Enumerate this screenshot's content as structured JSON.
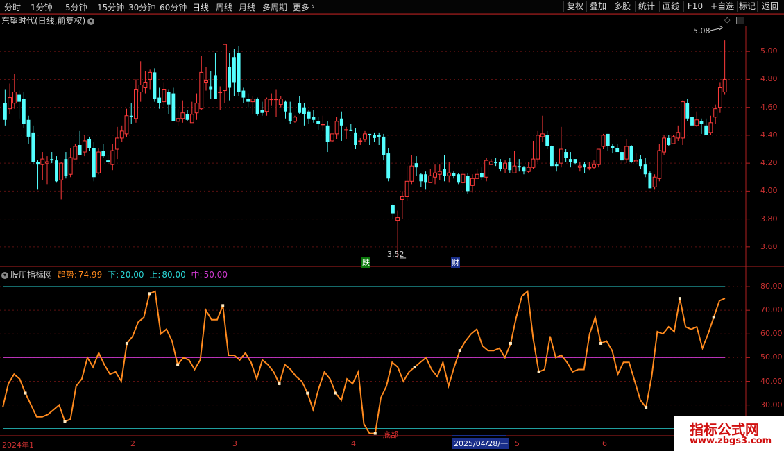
{
  "toolbar": {
    "timeframes": [
      "分时",
      "1分钟",
      "5分钟",
      "15分钟",
      "30分钟",
      "60分钟",
      "日线",
      "周线",
      "月线",
      "多周期",
      "更多"
    ],
    "active": "日线",
    "right_buttons": [
      "复权",
      "叠加",
      "多股",
      "统计",
      "画线",
      "F10",
      "+自选",
      "返回"
    ]
  },
  "main_chart": {
    "title": "东望时代(日线,前复权)",
    "y_ticks": [
      "5.00",
      "4.80",
      "4.60",
      "4.40",
      "4.20",
      "4.00",
      "3.80",
      "3.60"
    ],
    "y_range": [
      3.46,
      5.18
    ],
    "high_label": "5.08",
    "low_label": "3.52",
    "marker_die": "跌",
    "marker_cai": "财",
    "candles": [
      [
        4.63,
        4.51,
        4.73,
        4.47
      ],
      [
        4.59,
        4.67,
        4.77,
        4.55
      ],
      [
        4.63,
        4.71,
        4.84,
        4.59
      ],
      [
        4.69,
        4.64,
        4.72,
        4.52
      ],
      [
        4.66,
        4.48,
        4.71,
        4.45
      ],
      [
        4.51,
        4.39,
        4.54,
        4.34
      ],
      [
        4.42,
        4.21,
        4.47,
        4.19
      ],
      [
        4.21,
        4.19,
        4.22,
        4.01
      ],
      [
        4.19,
        4.23,
        4.28,
        4.08
      ],
      [
        4.2,
        4.21,
        4.25,
        4.05
      ],
      [
        4.23,
        4.22,
        4.28,
        4.2
      ],
      [
        4.22,
        4.07,
        4.25,
        4.06
      ],
      [
        4.08,
        4.2,
        4.21,
        3.94
      ],
      [
        4.23,
        4.11,
        4.28,
        4.09
      ],
      [
        4.12,
        4.24,
        4.31,
        4.1
      ],
      [
        4.23,
        4.32,
        4.34,
        4.23
      ],
      [
        4.33,
        4.26,
        4.43,
        4.26
      ],
      [
        4.28,
        4.36,
        4.4,
        4.25
      ],
      [
        4.37,
        4.31,
        4.39,
        4.29
      ],
      [
        4.31,
        4.1,
        4.35,
        4.07
      ],
      [
        4.13,
        4.28,
        4.31,
        4.12
      ],
      [
        4.29,
        4.25,
        4.34,
        4.24
      ],
      [
        4.22,
        4.21,
        4.26,
        4.19
      ],
      [
        4.19,
        4.29,
        4.34,
        4.15
      ],
      [
        4.3,
        4.38,
        4.46,
        4.23
      ],
      [
        4.38,
        4.43,
        4.47,
        4.35
      ],
      [
        4.41,
        4.54,
        4.59,
        4.39
      ],
      [
        4.54,
        4.53,
        4.63,
        4.48
      ],
      [
        4.52,
        4.73,
        4.8,
        4.49
      ],
      [
        4.71,
        4.76,
        4.93,
        4.64
      ],
      [
        4.74,
        4.78,
        4.86,
        4.7
      ],
      [
        4.8,
        4.85,
        4.87,
        4.73
      ],
      [
        4.85,
        4.66,
        4.88,
        4.64
      ],
      [
        4.67,
        4.63,
        4.74,
        4.59
      ],
      [
        4.64,
        4.73,
        4.78,
        4.61
      ],
      [
        4.71,
        4.62,
        4.73,
        4.55
      ],
      [
        4.7,
        4.5,
        4.74,
        4.5
      ],
      [
        4.5,
        4.52,
        4.59,
        4.47
      ],
      [
        4.52,
        4.56,
        4.65,
        4.49
      ],
      [
        4.55,
        4.51,
        4.58,
        4.5
      ],
      [
        4.49,
        4.55,
        4.64,
        4.49
      ],
      [
        4.56,
        4.63,
        4.7,
        4.51
      ],
      [
        4.59,
        4.85,
        4.97,
        4.58
      ],
      [
        4.78,
        4.79,
        4.89,
        4.72
      ],
      [
        4.75,
        4.73,
        4.86,
        4.66
      ],
      [
        4.83,
        4.66,
        4.99,
        4.66
      ],
      [
        4.71,
        4.71,
        4.75,
        4.58
      ],
      [
        4.72,
        5.05,
        5.05,
        4.63
      ],
      [
        4.89,
        4.74,
        4.99,
        4.65
      ],
      [
        4.96,
        4.78,
        5.02,
        4.68
      ],
      [
        4.99,
        4.71,
        5.04,
        4.68
      ],
      [
        4.72,
        4.67,
        4.74,
        4.63
      ],
      [
        4.66,
        4.64,
        4.7,
        4.6
      ],
      [
        4.64,
        4.66,
        4.68,
        4.55
      ],
      [
        4.66,
        4.55,
        4.67,
        4.54
      ],
      [
        4.58,
        4.56,
        4.64,
        4.54
      ],
      [
        4.57,
        4.66,
        4.67,
        4.54
      ],
      [
        4.66,
        4.66,
        4.7,
        4.61
      ],
      [
        4.66,
        4.66,
        4.73,
        4.53
      ],
      [
        4.62,
        4.66,
        4.68,
        4.6
      ],
      [
        4.64,
        4.57,
        4.65,
        4.52
      ],
      [
        4.56,
        4.5,
        4.64,
        4.48
      ],
      [
        4.5,
        4.53,
        4.54,
        4.49
      ],
      [
        4.63,
        4.56,
        4.68,
        4.55
      ],
      [
        4.6,
        4.55,
        4.63,
        4.47
      ],
      [
        4.57,
        4.52,
        4.58,
        4.48
      ],
      [
        4.53,
        4.51,
        4.58,
        4.49
      ],
      [
        4.5,
        4.48,
        4.53,
        4.44
      ],
      [
        4.48,
        4.48,
        4.54,
        4.43
      ],
      [
        4.47,
        4.35,
        4.5,
        4.28
      ],
      [
        4.36,
        4.41,
        4.41,
        4.35
      ],
      [
        4.41,
        4.5,
        4.53,
        4.37
      ],
      [
        4.52,
        4.47,
        4.57,
        4.36
      ],
      [
        4.44,
        4.44,
        4.46,
        4.37
      ],
      [
        4.44,
        4.43,
        4.48,
        4.43
      ],
      [
        4.42,
        4.33,
        4.45,
        4.3
      ],
      [
        4.36,
        4.36,
        4.38,
        4.33
      ],
      [
        4.37,
        4.41,
        4.43,
        4.35
      ],
      [
        4.41,
        4.4,
        4.41,
        4.33
      ],
      [
        4.4,
        4.38,
        4.42,
        4.35
      ],
      [
        4.4,
        4.39,
        4.42,
        4.33
      ],
      [
        4.39,
        4.26,
        4.41,
        4.22
      ],
      [
        4.27,
        4.09,
        4.31,
        4.07
      ],
      [
        3.9,
        3.84,
        3.91,
        3.8
      ],
      [
        3.79,
        3.81,
        3.86,
        3.52
      ],
      [
        3.94,
        3.96,
        4.0,
        3.8
      ],
      [
        3.96,
        4.07,
        4.18,
        3.93
      ],
      [
        4.07,
        4.18,
        4.26,
        4.05
      ],
      [
        4.2,
        4.17,
        4.25,
        4.11
      ],
      [
        4.12,
        4.07,
        4.13,
        4.03
      ],
      [
        4.12,
        4.06,
        4.14,
        4.01
      ],
      [
        4.06,
        4.11,
        4.16,
        4.06
      ],
      [
        4.1,
        4.13,
        4.19,
        4.05
      ],
      [
        4.12,
        4.14,
        4.19,
        4.08
      ],
      [
        4.16,
        4.11,
        4.26,
        4.07
      ],
      [
        4.11,
        4.13,
        4.21,
        4.06
      ],
      [
        4.13,
        4.11,
        4.14,
        4.09
      ],
      [
        4.12,
        4.06,
        4.13,
        4.05
      ],
      [
        4.06,
        4.12,
        4.15,
        4.05
      ],
      [
        4.11,
        4.0,
        4.13,
        3.98
      ],
      [
        4.04,
        4.09,
        4.12,
        3.99
      ],
      [
        4.09,
        4.12,
        4.16,
        4.09
      ],
      [
        4.13,
        4.1,
        4.17,
        4.08
      ],
      [
        4.1,
        4.22,
        4.24,
        4.07
      ],
      [
        4.19,
        4.21,
        4.23,
        4.19
      ],
      [
        4.21,
        4.2,
        4.24,
        4.18
      ],
      [
        4.21,
        4.16,
        4.23,
        4.14
      ],
      [
        4.16,
        4.2,
        4.22,
        4.13
      ],
      [
        4.21,
        4.15,
        4.24,
        4.13
      ],
      [
        4.13,
        4.18,
        4.29,
        4.13
      ],
      [
        4.18,
        4.17,
        4.23,
        4.14
      ],
      [
        4.17,
        4.14,
        4.18,
        4.12
      ],
      [
        4.14,
        4.17,
        4.21,
        4.13
      ],
      [
        4.17,
        4.23,
        4.36,
        4.16
      ],
      [
        4.23,
        4.4,
        4.43,
        4.21
      ],
      [
        4.39,
        4.41,
        4.54,
        4.35
      ],
      [
        4.4,
        4.32,
        4.43,
        4.3
      ],
      [
        4.32,
        4.18,
        4.33,
        4.17
      ],
      [
        4.19,
        4.18,
        4.21,
        4.14
      ],
      [
        4.2,
        4.3,
        4.46,
        4.17
      ],
      [
        4.28,
        4.24,
        4.3,
        4.21
      ],
      [
        4.23,
        4.21,
        4.28,
        4.17
      ],
      [
        4.23,
        4.2,
        4.22,
        4.19
      ],
      [
        4.17,
        4.18,
        4.21,
        4.14
      ],
      [
        4.19,
        4.17,
        4.21,
        4.13
      ],
      [
        4.17,
        4.17,
        4.21,
        4.15
      ],
      [
        4.17,
        4.19,
        4.22,
        4.16
      ],
      [
        4.19,
        4.3,
        4.3,
        4.17
      ],
      [
        4.32,
        4.4,
        4.41,
        4.3
      ],
      [
        4.41,
        4.32,
        4.41,
        4.29
      ],
      [
        4.32,
        4.31,
        4.34,
        4.27
      ],
      [
        4.31,
        4.28,
        4.34,
        4.28
      ],
      [
        4.28,
        4.22,
        4.3,
        4.2
      ],
      [
        4.23,
        4.32,
        4.37,
        4.2
      ],
      [
        4.32,
        4.21,
        4.33,
        4.2
      ],
      [
        4.21,
        4.22,
        4.27,
        4.19
      ],
      [
        4.23,
        4.18,
        4.26,
        4.16
      ],
      [
        4.19,
        4.12,
        4.24,
        4.1
      ],
      [
        4.13,
        4.02,
        4.14,
        4.02
      ],
      [
        4.03,
        4.1,
        4.12,
        4.01
      ],
      [
        4.09,
        4.29,
        4.34,
        4.07
      ],
      [
        4.28,
        4.38,
        4.4,
        4.26
      ],
      [
        4.38,
        4.33,
        4.4,
        4.32
      ],
      [
        4.34,
        4.39,
        4.4,
        4.34
      ],
      [
        4.38,
        4.42,
        4.47,
        4.36
      ],
      [
        4.38,
        4.64,
        4.65,
        4.33
      ],
      [
        4.63,
        4.52,
        4.66,
        4.5
      ],
      [
        4.53,
        4.47,
        4.55,
        4.46
      ],
      [
        4.47,
        4.51,
        4.57,
        4.46
      ],
      [
        4.5,
        4.48,
        4.52,
        4.41
      ],
      [
        4.47,
        4.4,
        4.52,
        4.4
      ],
      [
        4.42,
        4.49,
        4.54,
        4.4
      ],
      [
        4.53,
        4.59,
        4.62,
        4.48
      ],
      [
        4.6,
        4.74,
        4.78,
        4.56
      ],
      [
        4.71,
        4.8,
        5.08,
        4.69
      ]
    ]
  },
  "indicator": {
    "name": "股朋指标网",
    "trend_label": "趋势:",
    "trend_value": "74.99",
    "down_label": "下:",
    "down_value": "20.00",
    "up_label": "上:",
    "up_value": "80.00",
    "mid_label": "中:",
    "mid_value": "50.00",
    "y_ticks": [
      "80.00",
      "70.00",
      "60.00",
      "50.00",
      "40.00",
      "30.00"
    ],
    "y_range": [
      17,
      85
    ],
    "bottom_label": "底部",
    "values": [
      29,
      39,
      43,
      41,
      35,
      30,
      25,
      25,
      26,
      28,
      30,
      23,
      24,
      38,
      41,
      50,
      46,
      52,
      47,
      43,
      44,
      40,
      56,
      59,
      65,
      67,
      77,
      78,
      60,
      62,
      57,
      47,
      50,
      49,
      45,
      49,
      70,
      66,
      66,
      72,
      51,
      51,
      49,
      52,
      48,
      41,
      49,
      47,
      44,
      39,
      47,
      45,
      42,
      40,
      35,
      28,
      37,
      44,
      41,
      35,
      32,
      41,
      39,
      44,
      22,
      18,
      18,
      33,
      38,
      48,
      46,
      40,
      44,
      46,
      48,
      50,
      45,
      42,
      48,
      38,
      46,
      53,
      57,
      60,
      62,
      55,
      53,
      53,
      54,
      50,
      56,
      67,
      76,
      78,
      58,
      44,
      45,
      59,
      50,
      51,
      48,
      44,
      45,
      45,
      60,
      67,
      56,
      57,
      53,
      43,
      48,
      48,
      40,
      32,
      29,
      42,
      61,
      60,
      63,
      61,
      75,
      63,
      62,
      63,
      54,
      60,
      67,
      74,
      75
    ],
    "markers": [
      4,
      11,
      22,
      26,
      31,
      39,
      49,
      54,
      59,
      66,
      73,
      81,
      90,
      95,
      106,
      114,
      120,
      126
    ]
  },
  "x_axis": {
    "labels": [
      "2024年1",
      "2",
      "3",
      "4",
      "2025/04/28/一",
      "5",
      "6"
    ]
  },
  "watermark": {
    "title": "指标公式网",
    "url": "www.zbgs3.com"
  },
  "colors": {
    "up": "#ff3b3b",
    "down": "#54ffff",
    "indicator_line": "#ff8a1e",
    "band_line": "#2ad4d4",
    "mid_line": "#d03ad0",
    "axis": "#c83030"
  }
}
